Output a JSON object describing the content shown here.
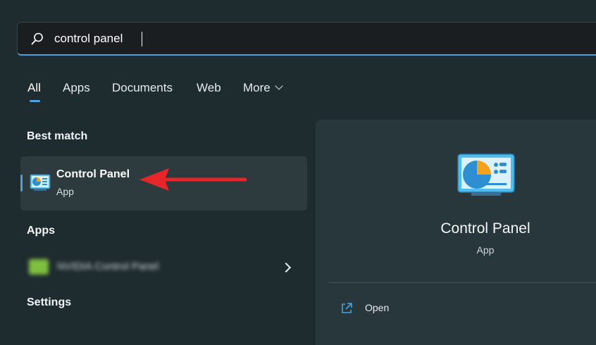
{
  "search": {
    "value": "control panel",
    "icon": "search-icon"
  },
  "tabs": [
    {
      "label": "All",
      "active": true
    },
    {
      "label": "Apps"
    },
    {
      "label": "Documents"
    },
    {
      "label": "Web"
    },
    {
      "label": "More"
    }
  ],
  "sections": {
    "best_match": "Best match",
    "apps": "Apps",
    "settings": "Settings"
  },
  "best_match": {
    "title": "Control Panel",
    "subtitle": "App",
    "icon": "control-panel-icon"
  },
  "apps": [
    {
      "label": "NVIDIA Control Panel",
      "blurred": true,
      "icon": "nvidia-icon"
    }
  ],
  "detail": {
    "title": "Control Panel",
    "subtitle": "App",
    "actions": [
      {
        "label": "Open",
        "icon": "open-external-icon"
      }
    ]
  },
  "colors": {
    "accent": "#4aa3df",
    "background": "#1e2b2f",
    "arrow": "#e8262a"
  }
}
